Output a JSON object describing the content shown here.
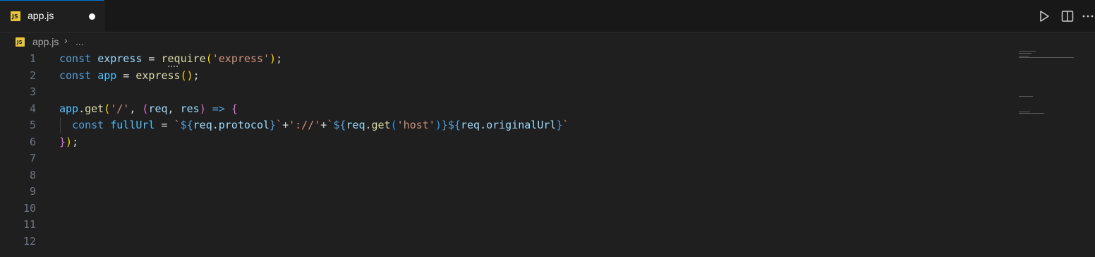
{
  "tab": {
    "icon": "javascript-file-icon",
    "icon_label": "JS",
    "label": "app.js"
  },
  "actions": {
    "run": "play-icon",
    "split": "split-editor-icon",
    "more": "more-actions-icon"
  },
  "breadcrumb": {
    "icon_label": "JS",
    "file": "app.js",
    "separator": "›",
    "more": "..."
  },
  "editor": {
    "lines": [
      {
        "n": "1",
        "tokens": [
          [
            "kw",
            "const"
          ],
          [
            "op",
            " "
          ],
          [
            "var",
            "express"
          ],
          [
            "op",
            " = "
          ],
          [
            "fn",
            "require"
          ],
          [
            "p1",
            "("
          ],
          [
            "str",
            "'express'"
          ],
          [
            "p1",
            ")"
          ],
          [
            "op",
            ";"
          ]
        ]
      },
      {
        "n": "2",
        "tokens": [
          [
            "kw",
            "const"
          ],
          [
            "op",
            " "
          ],
          [
            "cvar",
            "app"
          ],
          [
            "op",
            " = "
          ],
          [
            "fn",
            "express"
          ],
          [
            "p1",
            "()"
          ],
          [
            "op",
            ";"
          ]
        ]
      },
      {
        "n": "3",
        "tokens": []
      },
      {
        "n": "4",
        "tokens": [
          [
            "cvar",
            "app"
          ],
          [
            "op",
            "."
          ],
          [
            "fn",
            "get"
          ],
          [
            "p1",
            "("
          ],
          [
            "str",
            "'/'"
          ],
          [
            "op",
            ", "
          ],
          [
            "p2",
            "("
          ],
          [
            "var",
            "req"
          ],
          [
            "op",
            ", "
          ],
          [
            "var",
            "res"
          ],
          [
            "p2",
            ")"
          ],
          [
            "op",
            " "
          ],
          [
            "kw",
            "=>"
          ],
          [
            "op",
            " "
          ],
          [
            "p2",
            "{"
          ]
        ]
      },
      {
        "n": "5",
        "tokens": [
          [
            "op",
            "  "
          ],
          [
            "kw",
            "const"
          ],
          [
            "op",
            " "
          ],
          [
            "cvar",
            "fullUrl"
          ],
          [
            "op",
            " = "
          ],
          [
            "str",
            "`"
          ],
          [
            "kw",
            "${"
          ],
          [
            "var",
            "req"
          ],
          [
            "op",
            "."
          ],
          [
            "var",
            "protocol"
          ],
          [
            "kw",
            "}"
          ],
          [
            "str",
            "`"
          ],
          [
            "op",
            "+"
          ],
          [
            "str",
            "'://'"
          ],
          [
            "op",
            "+"
          ],
          [
            "str",
            "`"
          ],
          [
            "kw",
            "${"
          ],
          [
            "var",
            "req"
          ],
          [
            "op",
            "."
          ],
          [
            "fn",
            "get"
          ],
          [
            "p3",
            "("
          ],
          [
            "str",
            "'host'"
          ],
          [
            "p3",
            ")"
          ],
          [
            "kw",
            "}${"
          ],
          [
            "var",
            "req"
          ],
          [
            "op",
            "."
          ],
          [
            "var",
            "originalUrl"
          ],
          [
            "kw",
            "}"
          ],
          [
            "str",
            "`"
          ]
        ]
      },
      {
        "n": "6",
        "tokens": [
          [
            "p2",
            "}"
          ],
          [
            "p1",
            ")"
          ],
          [
            "op",
            ";"
          ]
        ]
      },
      {
        "n": "7",
        "tokens": []
      },
      {
        "n": "8",
        "tokens": []
      },
      {
        "n": "9",
        "tokens": []
      },
      {
        "n": "10",
        "tokens": []
      },
      {
        "n": "11",
        "tokens": []
      },
      {
        "n": "12",
        "tokens": []
      }
    ]
  }
}
